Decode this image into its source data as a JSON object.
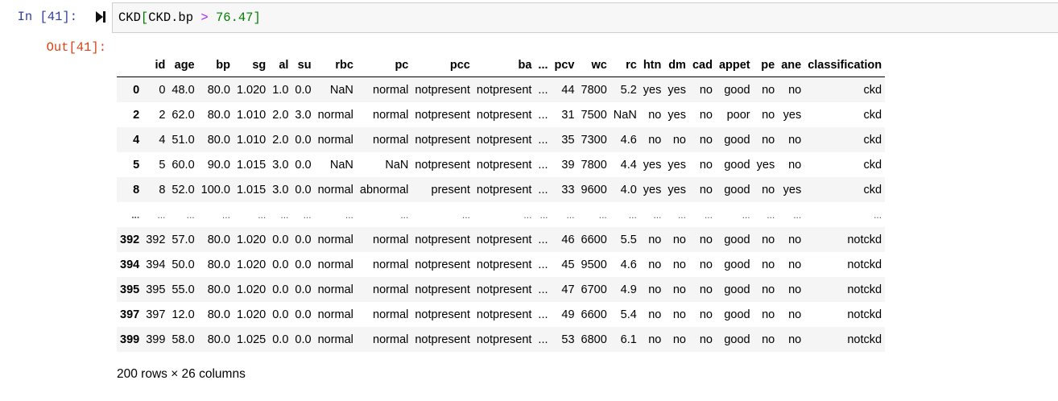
{
  "input_cell": {
    "prompt": "In [41]:",
    "code_parts": {
      "var": "CKD",
      "open": "[",
      "expr": "CKD.bp",
      "op": ">",
      "num": "76.47",
      "close": "]"
    }
  },
  "output_cell": {
    "prompt": "Out[41]:",
    "shape_text": "200 rows × 26 columns"
  },
  "table": {
    "columns": [
      "id",
      "age",
      "bp",
      "sg",
      "al",
      "su",
      "rbc",
      "pc",
      "pcc",
      "ba",
      "...",
      "pcv",
      "wc",
      "rc",
      "htn",
      "dm",
      "cad",
      "appet",
      "pe",
      "ane",
      "classification"
    ],
    "index": [
      "0",
      "2",
      "4",
      "5",
      "8",
      "...",
      "392",
      "394",
      "395",
      "397",
      "399"
    ],
    "rows": [
      [
        "0",
        "48.0",
        "80.0",
        "1.020",
        "1.0",
        "0.0",
        "NaN",
        "normal",
        "notpresent",
        "notpresent",
        "...",
        "44",
        "7800",
        "5.2",
        "yes",
        "yes",
        "no",
        "good",
        "no",
        "no",
        "ckd"
      ],
      [
        "2",
        "62.0",
        "80.0",
        "1.010",
        "2.0",
        "3.0",
        "normal",
        "normal",
        "notpresent",
        "notpresent",
        "...",
        "31",
        "7500",
        "NaN",
        "no",
        "yes",
        "no",
        "poor",
        "no",
        "yes",
        "ckd"
      ],
      [
        "4",
        "51.0",
        "80.0",
        "1.010",
        "2.0",
        "0.0",
        "normal",
        "normal",
        "notpresent",
        "notpresent",
        "...",
        "35",
        "7300",
        "4.6",
        "no",
        "no",
        "no",
        "good",
        "no",
        "no",
        "ckd"
      ],
      [
        "5",
        "60.0",
        "90.0",
        "1.015",
        "3.0",
        "0.0",
        "NaN",
        "NaN",
        "notpresent",
        "notpresent",
        "...",
        "39",
        "7800",
        "4.4",
        "yes",
        "yes",
        "no",
        "good",
        "yes",
        "no",
        "ckd"
      ],
      [
        "8",
        "52.0",
        "100.0",
        "1.015",
        "3.0",
        "0.0",
        "normal",
        "abnormal",
        "present",
        "notpresent",
        "...",
        "33",
        "9600",
        "4.0",
        "yes",
        "yes",
        "no",
        "good",
        "no",
        "yes",
        "ckd"
      ],
      [
        "...",
        "...",
        "...",
        "...",
        "...",
        "...",
        "...",
        "...",
        "...",
        "...",
        "...",
        "...",
        "...",
        "...",
        "...",
        "...",
        "...",
        "...",
        "...",
        "...",
        "..."
      ],
      [
        "392",
        "57.0",
        "80.0",
        "1.020",
        "0.0",
        "0.0",
        "normal",
        "normal",
        "notpresent",
        "notpresent",
        "...",
        "46",
        "6600",
        "5.5",
        "no",
        "no",
        "no",
        "good",
        "no",
        "no",
        "notckd"
      ],
      [
        "394",
        "50.0",
        "80.0",
        "1.020",
        "0.0",
        "0.0",
        "normal",
        "normal",
        "notpresent",
        "notpresent",
        "...",
        "45",
        "9500",
        "4.6",
        "no",
        "no",
        "no",
        "good",
        "no",
        "no",
        "notckd"
      ],
      [
        "395",
        "55.0",
        "80.0",
        "1.020",
        "0.0",
        "0.0",
        "normal",
        "normal",
        "notpresent",
        "notpresent",
        "...",
        "47",
        "6700",
        "4.9",
        "no",
        "no",
        "no",
        "good",
        "no",
        "no",
        "notckd"
      ],
      [
        "397",
        "12.0",
        "80.0",
        "1.020",
        "0.0",
        "0.0",
        "normal",
        "normal",
        "notpresent",
        "notpresent",
        "...",
        "49",
        "6600",
        "5.4",
        "no",
        "no",
        "no",
        "good",
        "no",
        "no",
        "notckd"
      ],
      [
        "399",
        "58.0",
        "80.0",
        "1.025",
        "0.0",
        "0.0",
        "normal",
        "normal",
        "notpresent",
        "notpresent",
        "...",
        "53",
        "6800",
        "6.1",
        "no",
        "no",
        "no",
        "good",
        "no",
        "no",
        "notckd"
      ]
    ]
  },
  "icons": {
    "run": "run-cell-icon"
  },
  "colors": {
    "in_prompt": "#303f9f",
    "out_prompt": "#d84315",
    "row_stripe": "#f5f5f5"
  }
}
